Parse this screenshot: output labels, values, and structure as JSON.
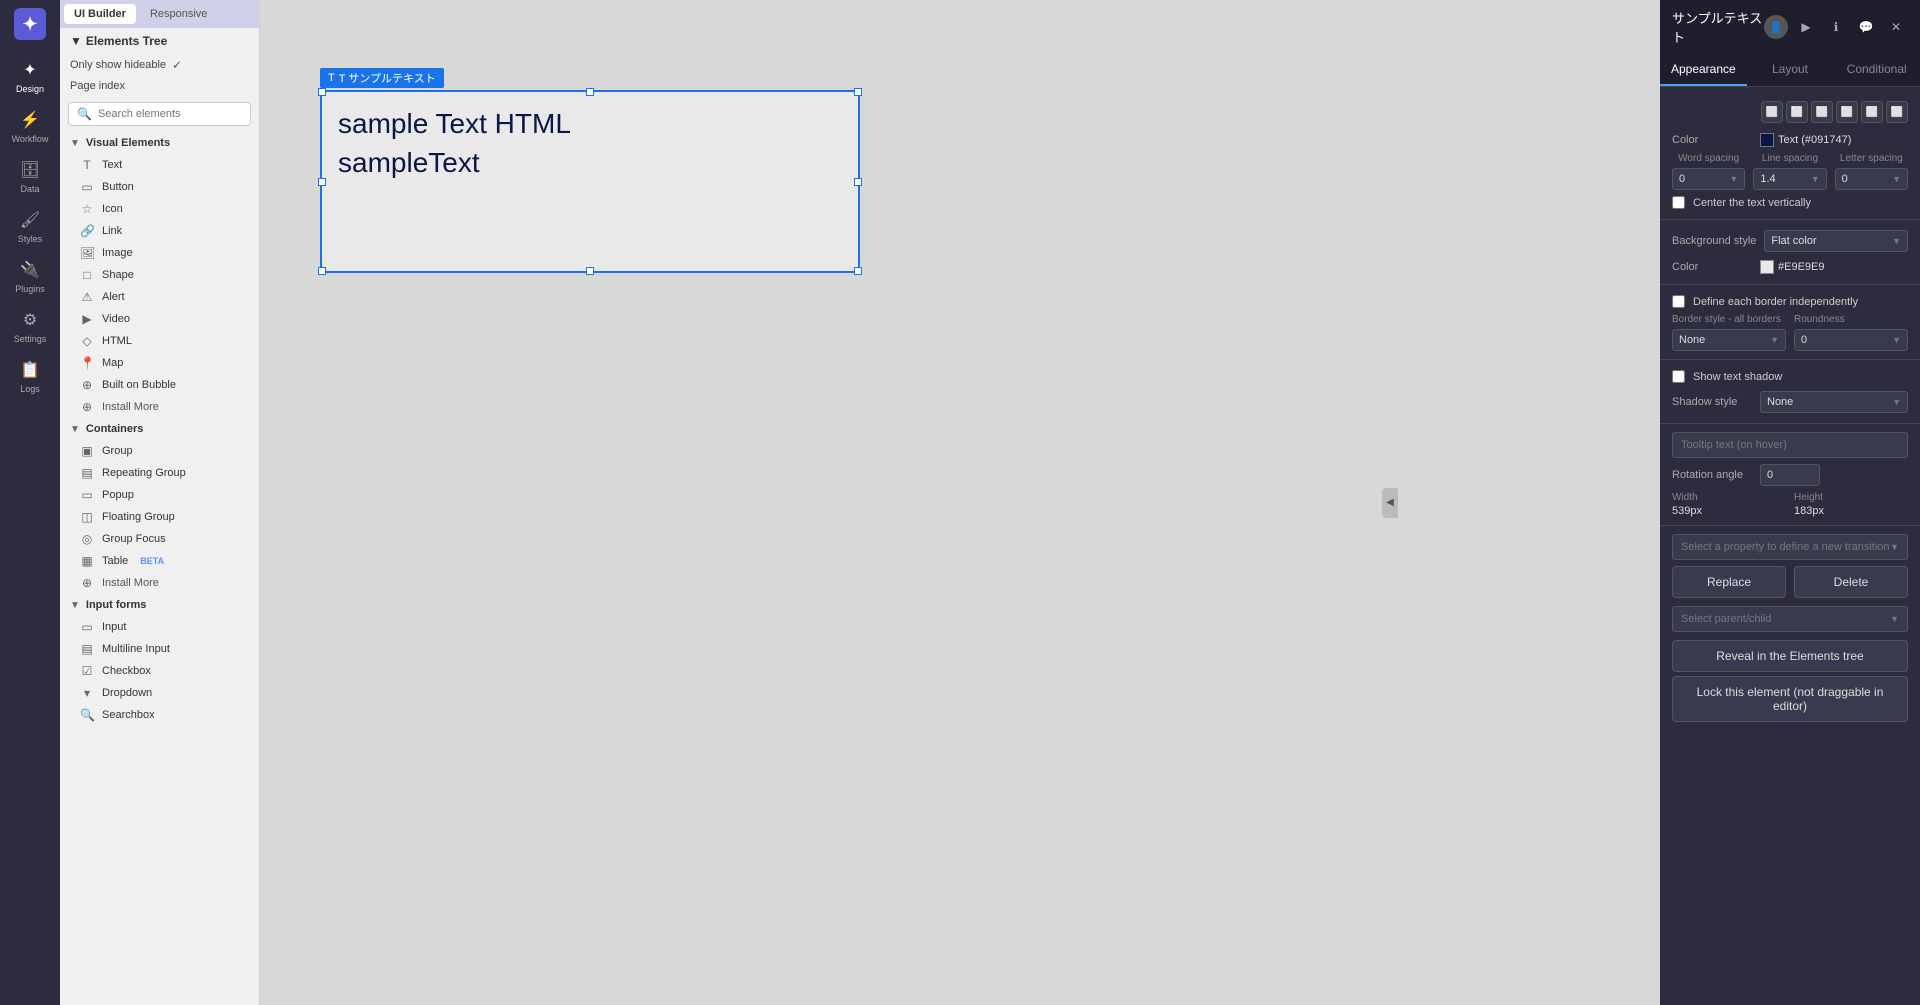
{
  "app": {
    "title": "UI Builder"
  },
  "nav": {
    "logo_icon": "✦",
    "items": [
      {
        "id": "design",
        "label": "Design",
        "icon": "✦",
        "active": true
      },
      {
        "id": "workflow",
        "label": "Workflow",
        "icon": "⚡"
      },
      {
        "id": "data",
        "label": "Data",
        "icon": "🗄"
      },
      {
        "id": "styles",
        "label": "Styles",
        "icon": "🖌"
      },
      {
        "id": "plugins",
        "label": "Plugins",
        "icon": "🔌"
      },
      {
        "id": "settings",
        "label": "Settings",
        "icon": "⚙"
      },
      {
        "id": "logs",
        "label": "Logs",
        "icon": "📋"
      }
    ]
  },
  "header": {
    "ui_builder_label": "UI Builder",
    "responsive_label": "Responsive"
  },
  "elements_panel": {
    "title": "Elements Tree",
    "only_show_hideable": "Only show hideable",
    "page_index": "Page index",
    "search_placeholder": "Search elements",
    "visual_elements_label": "Visual Elements",
    "containers_label": "Containers",
    "input_forms_label": "Input forms",
    "elements": {
      "visual": [
        {
          "id": "text",
          "label": "Text",
          "icon": "T"
        },
        {
          "id": "button",
          "label": "Button",
          "icon": "▭"
        },
        {
          "id": "icon",
          "label": "Icon",
          "icon": "☆"
        },
        {
          "id": "link",
          "label": "Link",
          "icon": "🔗"
        },
        {
          "id": "image",
          "label": "Image",
          "icon": "🖼"
        },
        {
          "id": "shape",
          "label": "Shape",
          "icon": "□"
        },
        {
          "id": "alert",
          "label": "Alert",
          "icon": "⚠"
        },
        {
          "id": "video",
          "label": "Video",
          "icon": "▶"
        },
        {
          "id": "html",
          "label": "HTML",
          "icon": "◇"
        },
        {
          "id": "map",
          "label": "Map",
          "icon": "📍"
        },
        {
          "id": "builtonbubble",
          "label": "Built on Bubble",
          "icon": "⊕"
        },
        {
          "id": "installmore_v",
          "label": "Install More",
          "icon": "⊕"
        }
      ],
      "containers": [
        {
          "id": "group",
          "label": "Group",
          "icon": "▣"
        },
        {
          "id": "repeatinggroup",
          "label": "Repeating Group",
          "icon": "▤"
        },
        {
          "id": "popup",
          "label": "Popup",
          "icon": "▭"
        },
        {
          "id": "floatinggroup",
          "label": "Floating Group",
          "icon": "◫"
        },
        {
          "id": "groupfocus",
          "label": "Group Focus",
          "icon": "◎"
        },
        {
          "id": "table",
          "label": "Table",
          "icon": "▦",
          "badge": "BETA"
        },
        {
          "id": "installmore_c",
          "label": "Install More",
          "icon": "⊕"
        }
      ],
      "input_forms": [
        {
          "id": "input",
          "label": "Input",
          "icon": "▭"
        },
        {
          "id": "multiline",
          "label": "Multiline Input",
          "icon": "▤"
        },
        {
          "id": "checkbox",
          "label": "Checkbox",
          "icon": "☑"
        },
        {
          "id": "dropdown",
          "label": "Dropdown",
          "icon": "▾"
        },
        {
          "id": "searchbox",
          "label": "Searchbox",
          "icon": "🔍"
        }
      ]
    }
  },
  "canvas": {
    "element_label": "T サンプルテキスト",
    "element_text_line1": "sample Text HTML",
    "element_text_line2": "sampleText"
  },
  "right_panel": {
    "title": "サンプルテキスト",
    "tabs": [
      {
        "id": "appearance",
        "label": "Appearance",
        "active": true
      },
      {
        "id": "layout",
        "label": "Layout"
      },
      {
        "id": "conditional",
        "label": "Conditional"
      }
    ],
    "appearance": {
      "color_label": "Color",
      "color_value": "Text (#091747)",
      "color_hex": "#091747",
      "word_spacing_label": "Word spacing",
      "word_spacing_value": "0",
      "line_spacing_label": "Line spacing",
      "line_spacing_value": "1.4",
      "letter_spacing_label": "Letter spacing",
      "letter_spacing_value": "0",
      "center_text_vertically": "Center the text vertically",
      "background_style_label": "Background style",
      "background_style_value": "Flat color",
      "bg_color_label": "Color",
      "bg_color_hex": "#E9E9E9",
      "define_border_label": "Define each border independently",
      "border_style_label": "Border style - all borders",
      "border_style_value": "None",
      "roundness_label": "Roundness",
      "roundness_value": "0",
      "show_shadow_label": "Show text shadow",
      "shadow_style_label": "Shadow style",
      "shadow_style_value": "None",
      "tooltip_label": "Tooltip text (on hover)",
      "rotation_label": "Rotation angle",
      "rotation_value": "0",
      "width_label": "Width",
      "width_value": "539px",
      "height_label": "Height",
      "height_value": "183px",
      "transition_placeholder": "Select a property to define a new transition",
      "replace_btn": "Replace",
      "delete_btn": "Delete",
      "select_parent_placeholder": "Select parent/child",
      "reveal_btn": "Reveal in the Elements tree",
      "lock_btn": "Lock this element (not draggable in editor)"
    }
  }
}
